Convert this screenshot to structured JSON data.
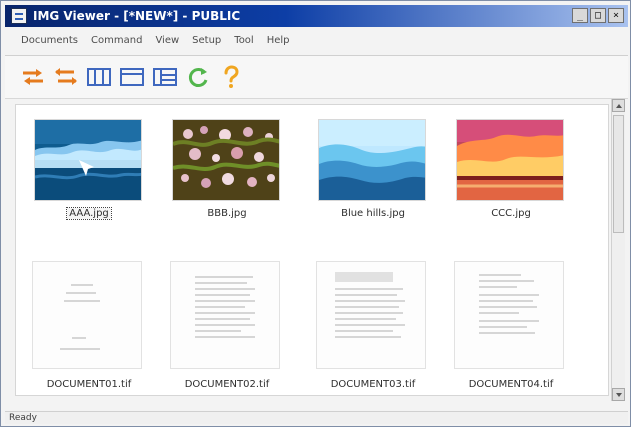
{
  "window": {
    "title": "IMG Viewer - [*NEW*] - PUBLIC",
    "controls": [
      "_",
      "□",
      "×"
    ]
  },
  "menu": {
    "items": [
      "Documents",
      "Command",
      "View",
      "Setup",
      "Tool",
      "Help"
    ]
  },
  "toolbar": {
    "buttons": [
      {
        "icon": "swap-arrows-icon",
        "color": "#e57b1e"
      },
      {
        "icon": "compare-arrows-icon",
        "color": "#e57b1e"
      },
      {
        "icon": "three-pane-icon",
        "color": "#3f68bf"
      },
      {
        "icon": "single-pane-icon",
        "color": "#3f68bf"
      },
      {
        "icon": "details-view-icon",
        "color": "#3f68bf"
      },
      {
        "icon": "refresh-icon",
        "color": "#53b64d"
      },
      {
        "icon": "help-icon",
        "color": "#f0a621"
      }
    ]
  },
  "content": {
    "thumbnails": [
      {
        "label": "AAA.jpg",
        "kind": "ocean"
      },
      {
        "label": "BBB.jpg",
        "kind": "flowers"
      },
      {
        "label": "Blue hills.jpg",
        "kind": "hills"
      },
      {
        "label": "CCC.jpg",
        "kind": "sunset"
      },
      {
        "label": "DOCUMENT01.tif",
        "kind": "document-a"
      },
      {
        "label": "DOCUMENT02.tif",
        "kind": "document-b"
      },
      {
        "label": "DOCUMENT03.tif",
        "kind": "document-c"
      },
      {
        "label": "DOCUMENT04.tif",
        "kind": "document-d"
      }
    ]
  },
  "status": {
    "text": "Ready"
  }
}
